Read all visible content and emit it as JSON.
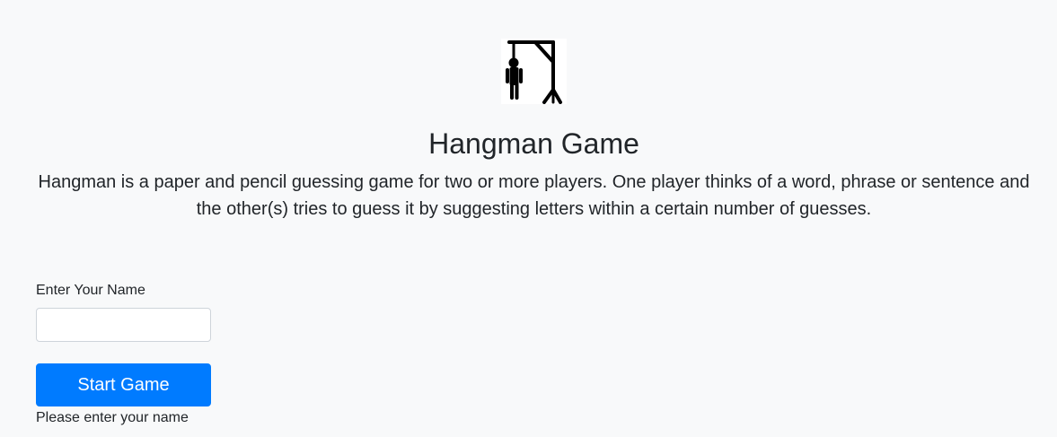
{
  "header": {
    "logo_icon": "hangman-gallows-icon",
    "title": "Hangman Game",
    "description": "Hangman is a paper and pencil guessing game for two or more players. One player thinks of a word, phrase or sentence and the other(s) tries to guess it by suggesting letters within a certain number of guesses."
  },
  "form": {
    "name_label": "Enter Your Name",
    "name_value": "",
    "name_placeholder": "",
    "start_button_label": "Start Game",
    "hint_text": "Please enter your name"
  },
  "colors": {
    "background": "#f8f9fa",
    "primary": "#007bff",
    "text": "#212529"
  }
}
